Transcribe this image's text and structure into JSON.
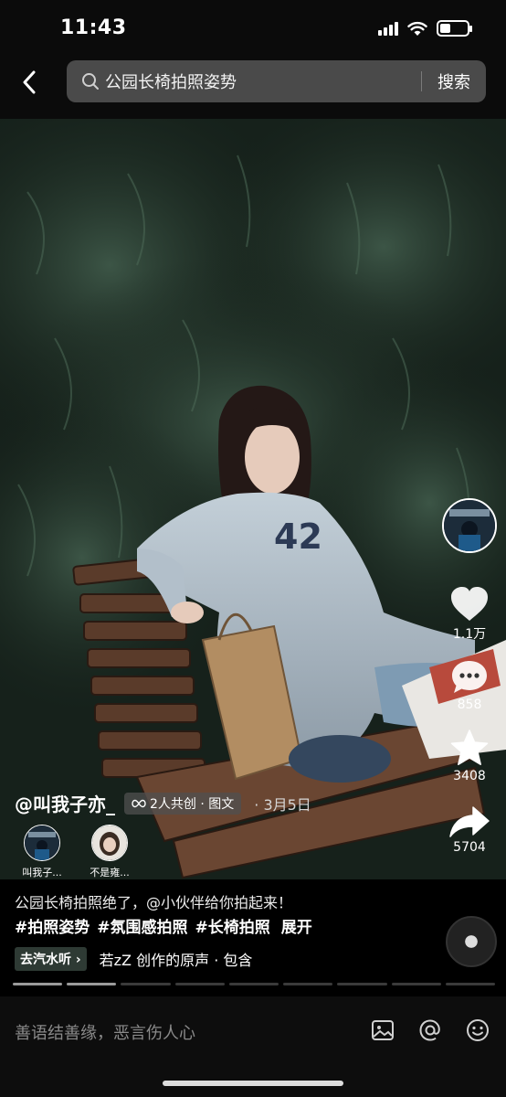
{
  "status_bar": {
    "time": "11:43",
    "battery_level": 0.4
  },
  "search": {
    "query": "公园长椅拍照姿势",
    "button_label": "搜索",
    "back_icon": "chevron-left-icon",
    "search_icon": "search-icon"
  },
  "actions": {
    "like": {
      "icon": "heart-icon",
      "count": "1.1万"
    },
    "comment": {
      "icon": "comment-bubble-icon",
      "count": "858"
    },
    "favorite": {
      "icon": "star-icon",
      "count": "3408"
    },
    "share": {
      "icon": "share-arrow-icon",
      "count": "5704"
    }
  },
  "post": {
    "author": "@叫我子亦_",
    "collab_badge": "2人共创 · 图文",
    "date": "· 3月5日",
    "co_creators": [
      {
        "name": "叫我子..."
      },
      {
        "name": "不是雍..."
      }
    ],
    "caption": "公园长椅拍照绝了，@小伙伴给你拍起来！",
    "hashtags": [
      "#拍照姿势",
      "#氛围感拍照",
      "#长椅拍照"
    ],
    "expand_label": "展开",
    "music_chip": "去汽水听",
    "music_text": "若zZ 创作的原声 · 包含"
  },
  "progress": {
    "total_segments": 9,
    "current_segment": 2
  },
  "comment_bar": {
    "placeholder": "善语结善缘，恶言伤人心",
    "icons": [
      "image-icon",
      "at-icon",
      "emoji-icon"
    ]
  },
  "colors": {
    "background": "#000000",
    "search_box": "#4a4a4a",
    "music_chip": "#2e3a34"
  }
}
